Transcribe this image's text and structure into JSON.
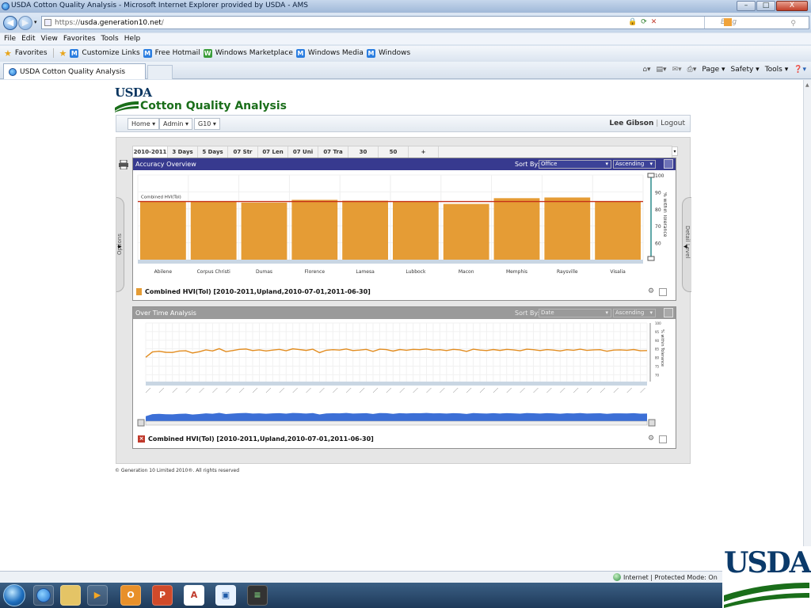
{
  "window": {
    "title": "USDA Cotton Quality Analysis - Microsoft Internet Explorer provided by USDA - AMS",
    "min": "–",
    "max": "□",
    "close": "X"
  },
  "address": {
    "prefix": "https://",
    "host": "usda.generation10.net",
    "path": "/",
    "search_placeholder": "Bing"
  },
  "menu": [
    "File",
    "Edit",
    "View",
    "Favorites",
    "Tools",
    "Help"
  ],
  "favorites": {
    "label": "Favorites",
    "links": [
      "Customize Links",
      "Free Hotmail",
      "Windows Marketplace",
      "Windows Media",
      "Windows"
    ]
  },
  "browser_tab": {
    "title": "USDA Cotton Quality Analysis"
  },
  "command_bar": [
    "Page ▾",
    "Safety ▾",
    "Tools ▾"
  ],
  "app": {
    "logo": "USDA",
    "title": "Cotton Quality Analysis",
    "nav": [
      "Home",
      "Admin",
      "G10"
    ],
    "user": "Lee Gibson",
    "sep": "|",
    "logout": "Logout"
  },
  "workspace": {
    "tabs": [
      "2010-2011",
      "3 Days",
      "5 Days",
      "07 Str",
      "07 Len",
      "07 Uni",
      "07 Tra",
      "30",
      "50",
      "+"
    ],
    "options_label": "Options",
    "detail_label": "Detail Level"
  },
  "panel1": {
    "title": "Accuracy Overview",
    "sort_by_label": "Sort By:",
    "sort_field": "Office",
    "sort_order": "Ascending",
    "legend": "Combined HVI(Tol) [2010-2011,Upland,2010-07-01,2011-06-30]"
  },
  "panel2": {
    "title": "Over Time Analysis",
    "sort_by_label": "Sort By:",
    "sort_field": "Date",
    "sort_order": "Ascending",
    "legend": "Combined HVI(Tol) [2010-2011,Upland,2010-07-01,2011-06-30]"
  },
  "footer": "© Generation 10 Limited 2010®. All rights reserved",
  "status": {
    "zone": "Internet | Protected Mode: On"
  },
  "corner_logo": "USDA",
  "colors": {
    "bar": "#e59c35",
    "line": "#e28c1f",
    "refline": "#c53018",
    "slider_area": "#3c6fd6",
    "panel1_header": "#373a8f"
  },
  "chart_data": [
    {
      "type": "bar",
      "title": "Accuracy Overview",
      "categories": [
        "Abilene",
        "Corpus Christi",
        "Dumas",
        "Florence",
        "Lamesa",
        "Lubbock",
        "Macon",
        "Memphis",
        "Raysville",
        "Visalia"
      ],
      "values": [
        84.6,
        84.4,
        83.7,
        85.3,
        84.8,
        84.2,
        82.9,
        86.3,
        86.7,
        84.6
      ],
      "reference_line": {
        "label": "Combined HVI(Tol)",
        "value": 84.3
      },
      "ylabel": "% within Tolerance",
      "yticks": [
        60,
        70,
        80,
        90,
        100
      ],
      "ylim": [
        50,
        100
      ],
      "grid": true,
      "legend": "bottom-left"
    },
    {
      "type": "line",
      "title": "Over Time Analysis",
      "ylabel": "% within Tolerance",
      "yticks": [
        70,
        75,
        80,
        85,
        90,
        95,
        100
      ],
      "ylim": [
        66,
        100
      ],
      "grid": true,
      "legend": "bottom-left",
      "series": [
        {
          "values": [
            80.1,
            83.2,
            83.6,
            83.0,
            82.9,
            83.7,
            83.9,
            82.6,
            83.3,
            84.4,
            83.8,
            85.1,
            83.4,
            84.0,
            84.7,
            84.9,
            84.0,
            84.4,
            83.8,
            84.3,
            84.7,
            83.9,
            85.0,
            84.6,
            84.1,
            84.8,
            82.8,
            84.2,
            84.5,
            84.3,
            84.9,
            84.0,
            84.3,
            84.7,
            83.5,
            84.8,
            84.6,
            83.7,
            84.6,
            84.2,
            84.7,
            84.5,
            84.9,
            84.3,
            84.5,
            84.0,
            84.7,
            84.4,
            83.5,
            84.8,
            84.3,
            84.0,
            84.6,
            84.1,
            84.7,
            84.4,
            83.9,
            84.8,
            84.5,
            84.0,
            84.6,
            84.3,
            83.8,
            84.5,
            84.2,
            84.8,
            84.1,
            84.4,
            84.5,
            83.6,
            84.3,
            84.4,
            84.2,
            84.6,
            83.9,
            84.0
          ]
        }
      ]
    }
  ]
}
